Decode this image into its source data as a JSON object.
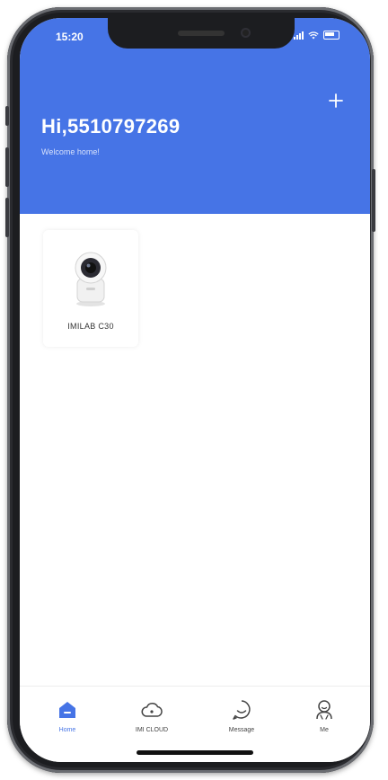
{
  "status": {
    "time": "15:20"
  },
  "header": {
    "greeting": "Hi,5510797269",
    "subtitle": "Welcome home!",
    "add_icon": "plus-icon"
  },
  "devices": [
    {
      "name": "IMILAB C30",
      "icon": "security-camera-icon"
    }
  ],
  "tabbar": {
    "tabs": [
      {
        "label": "Home",
        "icon": "home-icon",
        "active": true
      },
      {
        "label": "IMI CLOUD",
        "icon": "cloud-icon",
        "active": false
      },
      {
        "label": "Message",
        "icon": "message-icon",
        "active": false
      },
      {
        "label": "Me",
        "icon": "person-icon",
        "active": false
      }
    ]
  },
  "colors": {
    "accent": "#4674e6",
    "background": "#ffffff",
    "bezel": "#1c1d20"
  }
}
